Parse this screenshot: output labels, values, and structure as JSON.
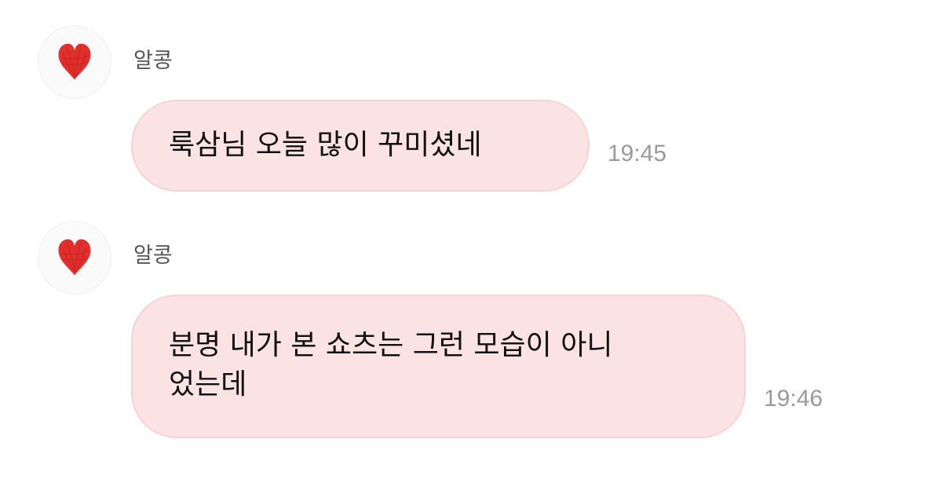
{
  "chat": {
    "messages": [
      {
        "sender": "알콩",
        "avatar_icon": "red-heart-icon",
        "text": "룩삼님 오늘 많이 꾸미셨네",
        "time": "19:45"
      },
      {
        "sender": "알콩",
        "avatar_icon": "red-heart-icon",
        "text": "분명 내가 본 쇼츠는 그런 모습이 아니\n었는데",
        "time": "19:46"
      }
    ]
  },
  "colors": {
    "bubble_bg": "#fbe2e5",
    "bubble_border": "#f7d2d7",
    "heart": "#e0302e",
    "sender_text": "#555555",
    "time_text": "#9a9a9a"
  }
}
